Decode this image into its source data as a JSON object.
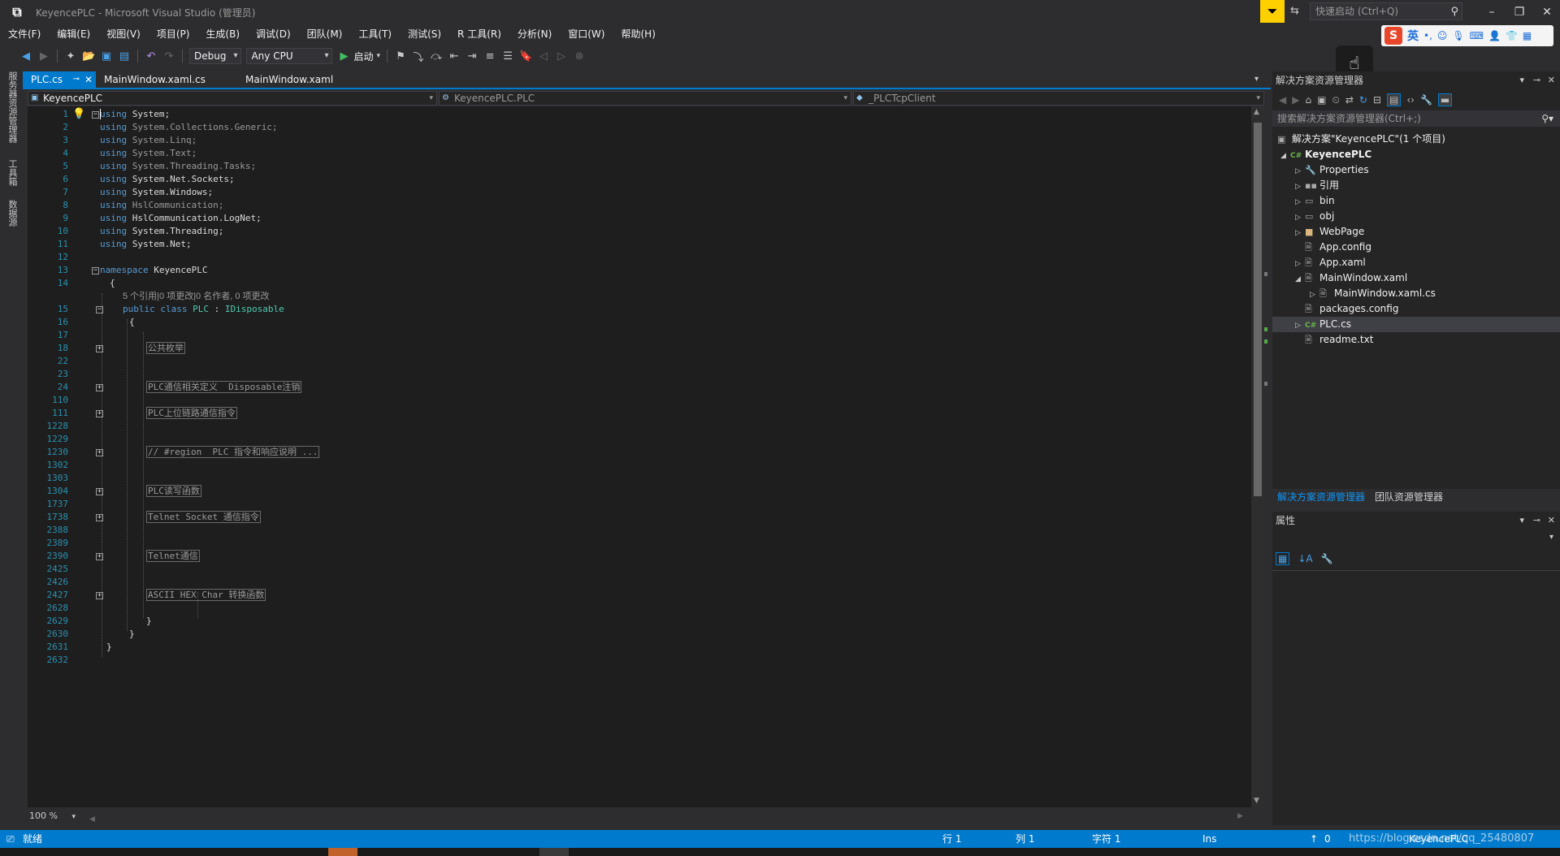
{
  "window": {
    "title": "KeyencePLC - Microsoft Visual Studio (管理员)",
    "quick_launch_placeholder": "快速启动 (Ctrl+Q)"
  },
  "menu": [
    "文件(F)",
    "编辑(E)",
    "视图(V)",
    "项目(P)",
    "生成(B)",
    "调试(D)",
    "团队(M)",
    "工具(T)",
    "测试(S)",
    "R 工具(R)",
    "分析(N)",
    "窗口(W)",
    "帮助(H)"
  ],
  "ime": {
    "logo": "S",
    "mode": "英"
  },
  "toolbar": {
    "config": "Debug",
    "platform": "Any CPU",
    "start_label": "启动"
  },
  "left_strip": [
    "服务器资源管理器",
    "工具箱",
    "数据源"
  ],
  "tabs": [
    {
      "label": "PLC.cs"
    },
    {
      "label": "MainWindow.xaml.cs"
    },
    {
      "label": "MainWindow.xaml"
    }
  ],
  "navbar": {
    "project": "KeyencePLC",
    "type": "KeyencePLC.PLC",
    "member": "_PLCTcpClient"
  },
  "editor": {
    "zoom": "100 %",
    "lines": [
      {
        "n": "1",
        "kw": "using",
        "t": " System;"
      },
      {
        "n": "2",
        "kw": "using",
        "t": " System.Collections.Generic;"
      },
      {
        "n": "3",
        "kw": "using",
        "t": " System.Linq;"
      },
      {
        "n": "4",
        "kw": "using",
        "t": " System.Text;"
      },
      {
        "n": "5",
        "kw": "using",
        "t": " System.Threading.Tasks;"
      },
      {
        "n": "6",
        "kw": "using",
        "t": " System.Net.Sockets;"
      },
      {
        "n": "7",
        "kw": "using",
        "t": " System.Windows;"
      },
      {
        "n": "8",
        "kw": "using",
        "t": " HslCommunication;"
      },
      {
        "n": "9",
        "kw": "using",
        "t": " HslCommunication.LogNet;"
      },
      {
        "n": "10",
        "kw": "using",
        "t": " System.Threading;"
      },
      {
        "n": "11",
        "kw": "using",
        "t": " System.Net;"
      },
      {
        "n": "12"
      },
      {
        "n": "13",
        "kw": "namespace",
        "t": " KeyencePLC"
      },
      {
        "n": "14",
        "t": "{"
      },
      {
        "lens": "5 个引用|0 项更改|0 名作者, 0 项更改"
      },
      {
        "n": "15",
        "cls": true
      },
      {
        "n": "16",
        "t": "{"
      },
      {
        "n": "17"
      },
      {
        "n": "18",
        "region": "公共枚举"
      },
      {
        "n": "22"
      },
      {
        "n": "23"
      },
      {
        "n": "24",
        "region": "PLC通信相关定义  Disposable注销"
      },
      {
        "n": "110"
      },
      {
        "n": "111",
        "region": "PLC上位链路通信指令"
      },
      {
        "n": "1228"
      },
      {
        "n": "1229"
      },
      {
        "n": "1230",
        "region": "// #region  PLC 指令和响应说明 ..."
      },
      {
        "n": "1302"
      },
      {
        "n": "1303"
      },
      {
        "n": "1304",
        "region": "PLC读写函数"
      },
      {
        "n": "1737"
      },
      {
        "n": "1738",
        "region": "Telnet Socket 通信指令"
      },
      {
        "n": "2388"
      },
      {
        "n": "2389"
      },
      {
        "n": "2390",
        "region": "Telnet通信"
      },
      {
        "n": "2425"
      },
      {
        "n": "2426"
      },
      {
        "n": "2427",
        "region": "ASCII HEX Char 转换函数"
      },
      {
        "n": "2628"
      },
      {
        "n": "2629",
        "t": "}"
      },
      {
        "n": "2630",
        "t": "}"
      },
      {
        "n": "2631",
        "t": "}"
      },
      {
        "n": "2632"
      }
    ],
    "class_decl": {
      "mods": "public class",
      "name": "PLC",
      "colon": " : ",
      "iface": "IDisposable"
    }
  },
  "solution_explorer": {
    "title": "解决方案资源管理器",
    "search_placeholder": "搜索解决方案资源管理器(Ctrl+;)",
    "nodes": [
      {
        "label": "解决方案\"KeyencePLC\"(1 个项目)"
      },
      {
        "label": "KeyencePLC"
      },
      {
        "label": "Properties"
      },
      {
        "label": "引用"
      },
      {
        "label": "bin"
      },
      {
        "label": "obj"
      },
      {
        "label": "WebPage"
      },
      {
        "label": "App.config"
      },
      {
        "label": "App.xaml"
      },
      {
        "label": "MainWindow.xaml"
      },
      {
        "label": "MainWindow.xaml.cs"
      },
      {
        "label": "packages.config"
      },
      {
        "label": "PLC.cs"
      },
      {
        "label": "readme.txt"
      }
    ],
    "tabs": [
      "解决方案资源管理器",
      "团队资源管理器"
    ]
  },
  "properties": {
    "title": "属性"
  },
  "status": {
    "ready": "就绪",
    "line": "行 1",
    "col": "列 1",
    "char": "字符 1",
    "ins": "Ins",
    "pending": "0",
    "repo": "KeyencePLC",
    "watermark": "https://blog.csdn.net/qq_25480807"
  },
  "colors": {
    "accent": "#007acc",
    "editor_bg": "#1e1e1e",
    "keyword": "#569cd6",
    "type": "#4ec9b0",
    "line_number": "#2b91af"
  }
}
